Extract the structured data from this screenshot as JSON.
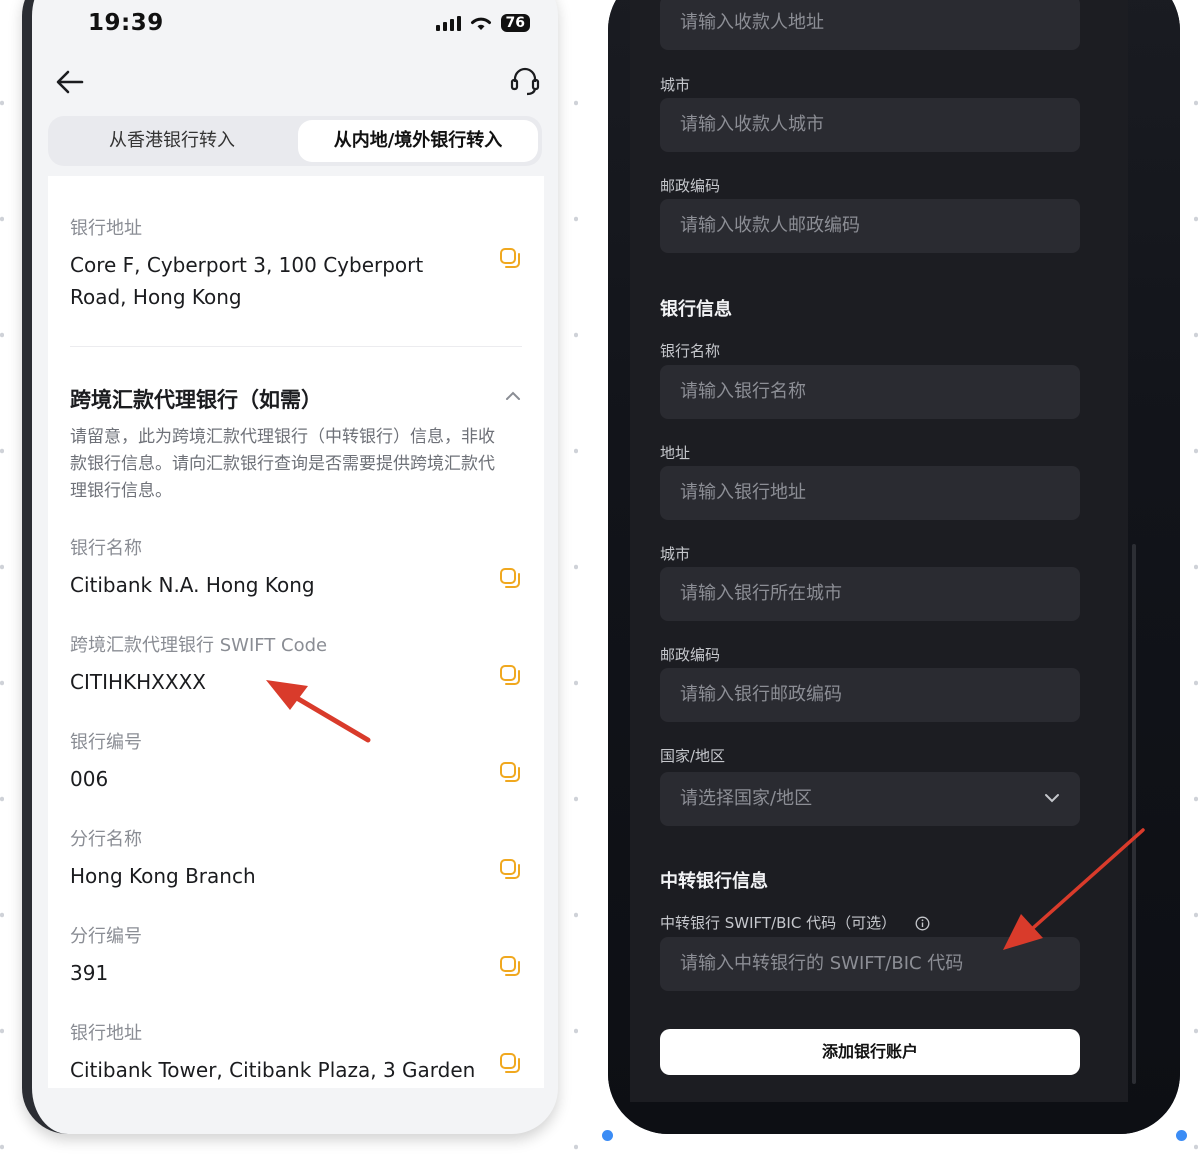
{
  "left_phone": {
    "status": {
      "time": "19:39",
      "battery": "76"
    },
    "tabs": [
      {
        "label": "从香港银行转入"
      },
      {
        "label": "从内地/境外银行转入"
      }
    ],
    "bank_address": {
      "label": "银行地址",
      "value": "Core F, Cyberport 3, 100 Cyberport Road, Hong Kong"
    },
    "intermediary": {
      "title": "跨境汇款代理银行（如需）",
      "note": "请留意，此为跨境汇款代理银行（中转银行）信息，非收款银行信息。请向汇款银行查询是否需要提供跨境汇款代理银行信息。",
      "fields": [
        {
          "label": "银行名称",
          "value": "Citibank N.A. Hong Kong"
        },
        {
          "label": "跨境汇款代理银行 SWIFT Code",
          "value": "CITIHKHXXXX"
        },
        {
          "label": "银行编号",
          "value": "006"
        },
        {
          "label": "分行名称",
          "value": "Hong Kong Branch"
        },
        {
          "label": "分行编号",
          "value": "391"
        },
        {
          "label": "银行地址",
          "value": "Citibank Tower, Citibank Plaza, 3 Garden"
        }
      ]
    },
    "icons": {
      "back": "arrow-left-icon",
      "support": "headset-icon",
      "copy": "copy-icon",
      "collapse": "chevron-up-icon"
    },
    "accent_color": "#f0a81f",
    "annotation_color": "#d93b2b"
  },
  "right_phone": {
    "payee": {
      "address_placeholder": "请输入收款人地址",
      "city_label": "城市",
      "city_placeholder": "请输入收款人城市",
      "postcode_label": "邮政编码",
      "postcode_placeholder": "请输入收款人邮政编码"
    },
    "bank_info": {
      "title": "银行信息",
      "name_label": "银行名称",
      "name_placeholder": "请输入银行名称",
      "address_label": "地址",
      "address_placeholder": "请输入银行地址",
      "city_label": "城市",
      "city_placeholder": "请输入银行所在城市",
      "postcode_label": "邮政编码",
      "postcode_placeholder": "请输入银行邮政编码",
      "country_label": "国家/地区",
      "country_placeholder": "请选择国家/地区"
    },
    "intermediary_info": {
      "title": "中转银行信息",
      "swift_label": "中转银行 SWIFT/BIC 代码（可选）",
      "swift_placeholder": "请输入中转银行的 SWIFT/BIC 代码"
    },
    "submit_label": "添加银行账户",
    "icons": {
      "select": "chevron-down-icon",
      "info": "info-icon"
    }
  }
}
